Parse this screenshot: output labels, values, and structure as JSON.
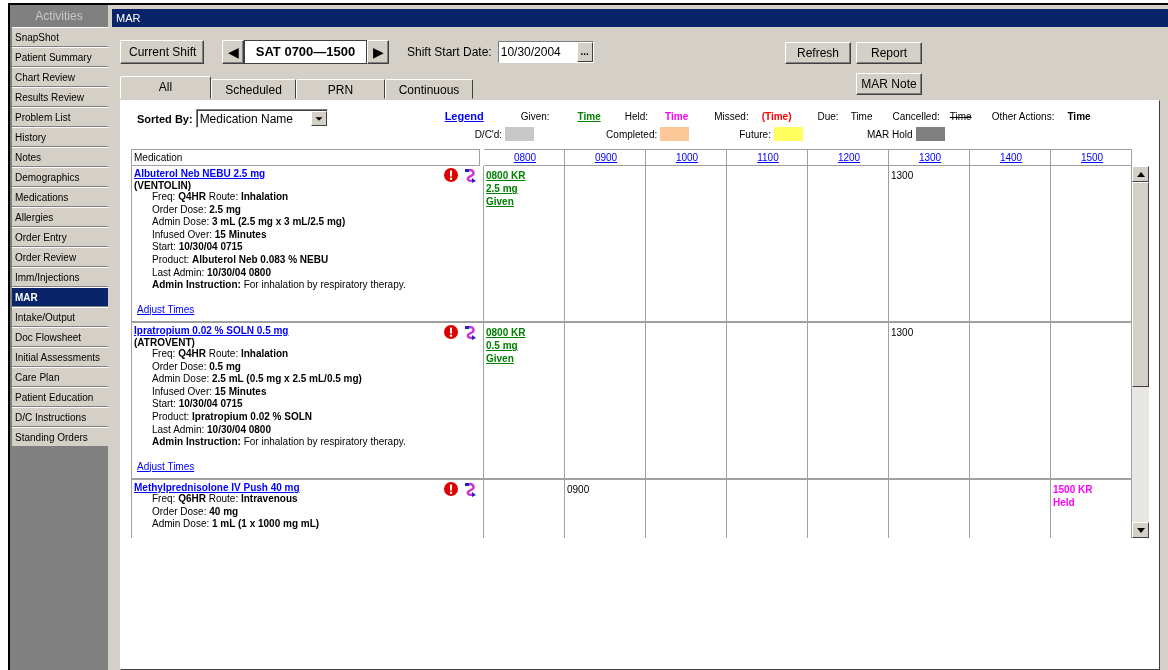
{
  "window": {
    "title": "MAR"
  },
  "sidebar": {
    "header": "Activities",
    "items": [
      {
        "label": "SnapShot",
        "selected": false
      },
      {
        "label": "Patient Summary",
        "selected": false
      },
      {
        "label": "Chart Review",
        "selected": false
      },
      {
        "label": "Results Review",
        "selected": false
      },
      {
        "label": "Problem List",
        "selected": false
      },
      {
        "label": "History",
        "selected": false
      },
      {
        "label": "Notes",
        "selected": false
      },
      {
        "label": "Demographics",
        "selected": false
      },
      {
        "label": "Medications",
        "selected": false
      },
      {
        "label": "Allergies",
        "selected": false
      },
      {
        "label": "Order Entry",
        "selected": false
      },
      {
        "label": "Order Review",
        "selected": false
      },
      {
        "label": "Imm/Injections",
        "selected": false
      },
      {
        "label": "MAR",
        "selected": true
      },
      {
        "label": "Intake/Output",
        "selected": false
      },
      {
        "label": "Doc Flowsheet",
        "selected": false
      },
      {
        "label": "Initial Assessments",
        "selected": false
      },
      {
        "label": "Care Plan",
        "selected": false
      },
      {
        "label": "Patient Education",
        "selected": false
      },
      {
        "label": "D/C Instructions",
        "selected": false
      },
      {
        "label": "Standing Orders",
        "selected": false
      }
    ]
  },
  "toolbar": {
    "current_shift_button": "Current Shift",
    "prev_button": "◀",
    "shift": "SAT 0700—1500",
    "next_button": "▶",
    "start_date_label": "Shift Start Date:",
    "start_date": "10/30/2004",
    "date_picker_button": "...",
    "buttons": [
      "Refresh",
      "Report",
      "MAR Note"
    ]
  },
  "tabs": [
    {
      "label": "All",
      "selected": true
    },
    {
      "label": "Scheduled",
      "selected": false
    },
    {
      "label": "PRN",
      "selected": false
    },
    {
      "label": "Continuous",
      "selected": false
    }
  ],
  "sort": {
    "label": "Sorted By:",
    "value": "Medication Name"
  },
  "legend": {
    "title": "Legend",
    "entries": [
      {
        "label": "Given:",
        "sample": "Time",
        "kind": "given"
      },
      {
        "label": "Held:",
        "sample": "Time",
        "kind": "held"
      },
      {
        "label": "Missed:",
        "sample": "(Time)",
        "kind": "missed"
      },
      {
        "label": "Due:",
        "sample": "Time",
        "kind": "due"
      },
      {
        "label": "Cancelled:",
        "sample": "Time",
        "kind": "cancelled"
      },
      {
        "label": "Other Actions:",
        "sample": "Time",
        "kind": "other"
      }
    ],
    "swatches": [
      {
        "label": "D/C'd:",
        "color": "#c8c8c8"
      },
      {
        "label": "Completed:",
        "color": "#fcc898"
      },
      {
        "label": "Future:",
        "color": "#ffff60"
      },
      {
        "label": "MAR Hold",
        "color": "#808080"
      }
    ]
  },
  "table": {
    "columns": [
      "Medication",
      "0800",
      "0900",
      "1000",
      "1100",
      "1200",
      "1300",
      "1400",
      "1500"
    ],
    "rows": [
      {
        "name": "Albuterol Neb NEBU 2.5 mg",
        "brand": "(VENTOLIN)",
        "details": [
          "Freq: **Q4HR**  Route: **Inhalation**",
          "Order Dose: **2.5 mg**",
          "Admin Dose: **3 mL (2.5 mg x 3 mL/2.5 mg)**",
          "Infused Over: **15 Minutes**",
          "Start: **10/30/04 0715**",
          "Product: **Albuterol Neb 0.083 % NEBU**",
          "Last Admin: **10/30/04 0800**",
          "**Admin Instruction:** For inhalation by respiratory therapy."
        ],
        "link": "Adjust Times",
        "cells": [
          {
            "kind": "given",
            "lines": [
              "0800 KR",
              "2.5 mg",
              "Given"
            ]
          },
          {},
          {},
          {},
          {},
          {
            "kind": "due",
            "lines": [
              "1300"
            ]
          },
          {},
          {}
        ]
      },
      {
        "name": "Ipratropium 0.02 % SOLN 0.5 mg",
        "brand": "(ATROVENT)",
        "details": [
          "Freq: **Q4HR**  Route: **Inhalation**",
          "Order Dose: **0.5 mg**",
          "Admin Dose: **2.5 mL (0.5 mg x 2.5 mL/0.5 mg)**",
          "Infused Over: **15 Minutes**",
          "Start: **10/30/04 0715**",
          "Product: **Ipratropium 0.02 % SOLN**",
          "Last Admin: **10/30/04 0800**",
          "**Admin Instruction:** For inhalation by respiratory therapy."
        ],
        "link": "Adjust Times",
        "cells": [
          {
            "kind": "given",
            "lines": [
              "0800 KR",
              "0.5 mg",
              "Given"
            ]
          },
          {},
          {},
          {},
          {},
          {
            "kind": "due",
            "lines": [
              "1300"
            ]
          },
          {},
          {}
        ]
      },
      {
        "name": "Methylprednisolone IV Push 40 mg",
        "details": [
          "Freq: **Q6HR**  Route: **Intravenous**",
          "Order Dose: **40 mg**",
          "Admin Dose: **1 mL (1 x 1000 mg mL)**"
        ],
        "cells": [
          {},
          {
            "kind": "due",
            "lines": [
              "0900"
            ]
          },
          {},
          {},
          {},
          {},
          {},
          {
            "kind": "held",
            "lines": [
              "1500 KR",
              "Held"
            ]
          }
        ]
      }
    ]
  }
}
